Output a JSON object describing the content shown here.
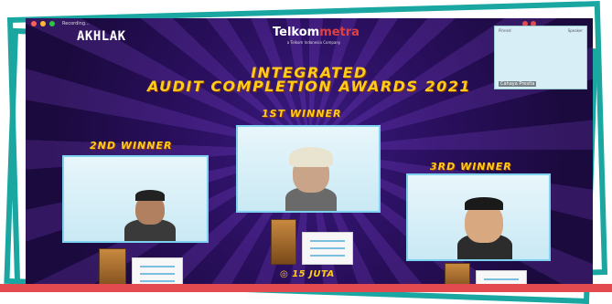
{
  "header": {
    "brand_left": "AKHLAK",
    "brand_center": "Telkom",
    "brand_center_accent": "metra",
    "brand_center_sub": "a Telkom Indonesia Company",
    "recording": "Recording..."
  },
  "title": {
    "line1": "INTEGRATED",
    "line2": "AUDIT COMPLETION AWARDS 2021"
  },
  "winners": {
    "first": "1ST WINNER",
    "second": "2ND WINNER",
    "third": "3RD WINNER",
    "prize": "15 JUTA"
  },
  "self_view": {
    "name": "Cahaya Presita",
    "label_left": "Pinned",
    "label_right": "Speaker"
  },
  "colors": {
    "teal_frame": "#1aa7a2",
    "title_yellow": "#ffcc1a",
    "red_bar": "#e34a4f",
    "bg_purple": "#2a0f5e"
  }
}
